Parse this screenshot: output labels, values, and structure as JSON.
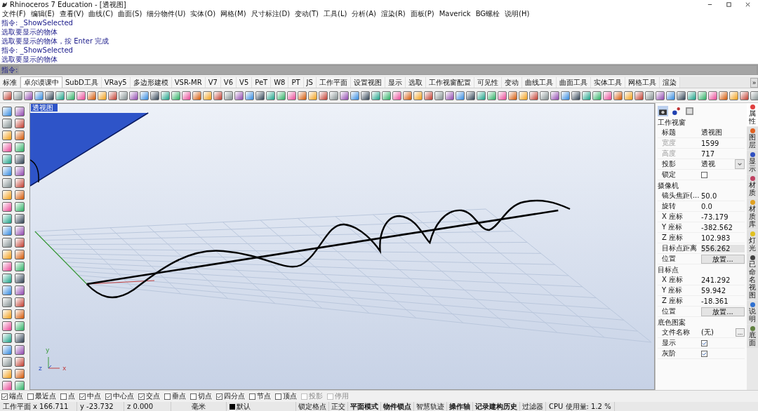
{
  "window": {
    "title": "Rhinoceros 7 Education - [透视图]"
  },
  "menu": [
    "文件(F)",
    "编辑(E)",
    "查看(V)",
    "曲线(C)",
    "曲面(S)",
    "细分物件(U)",
    "实体(O)",
    "网格(M)",
    "尺寸标注(D)",
    "变动(T)",
    "工具(L)",
    "分析(A)",
    "渲染(R)",
    "面板(P)",
    "Maverick",
    "BG螺栓",
    "说明(H)"
  ],
  "command_history": [
    "指令: _ShowSelected",
    "选取要显示的物体",
    "选取要显示的物体，按 Enter 完成",
    "指令: _ShowSelected",
    "选取要显示的物体"
  ],
  "command_prompt": {
    "label": "指令:"
  },
  "tabs": [
    {
      "label": "标准",
      "selected": false
    },
    {
      "label": "卓尔谟课中",
      "selected": true
    },
    {
      "label": "SubD工具",
      "selected": false
    },
    {
      "label": "VRay5",
      "selected": false
    },
    {
      "label": "多边形建模",
      "selected": false
    },
    {
      "label": "VSR-MR",
      "selected": false
    },
    {
      "label": "V7",
      "selected": false
    },
    {
      "label": "V6",
      "selected": false
    },
    {
      "label": "V5",
      "selected": false
    },
    {
      "label": "PeT",
      "selected": false
    },
    {
      "label": "W8",
      "selected": false
    },
    {
      "label": "PT",
      "selected": false
    },
    {
      "label": "JS",
      "selected": false
    },
    {
      "label": "工作平面",
      "selected": false
    },
    {
      "label": "设置视图",
      "selected": false
    },
    {
      "label": "显示",
      "selected": false
    },
    {
      "label": "选取",
      "selected": false
    },
    {
      "label": "工作视窗配置",
      "selected": false
    },
    {
      "label": "可见性",
      "selected": false
    },
    {
      "label": "变动",
      "selected": false
    },
    {
      "label": "曲线工具",
      "selected": false
    },
    {
      "label": "曲面工具",
      "selected": false
    },
    {
      "label": "实体工具",
      "selected": false
    },
    {
      "label": "网格工具",
      "selected": false
    },
    {
      "label": "渲染",
      "selected": false
    }
  ],
  "tabs_more": "»",
  "viewport": {
    "title": "透视图",
    "axes": [
      "x",
      "y",
      "z"
    ]
  },
  "properties": {
    "sections": [
      {
        "title": "工作视窗",
        "rows": [
          {
            "kind": "text",
            "label": "标题",
            "value": "透视图",
            "disabled": false
          },
          {
            "kind": "text",
            "label": "宽度",
            "value": "1599",
            "disabled": true
          },
          {
            "kind": "text",
            "label": "高度",
            "value": "717",
            "disabled": true
          },
          {
            "kind": "dropdown",
            "label": "投影",
            "value": "透视",
            "disabled": false
          },
          {
            "kind": "checkbox",
            "label": "锁定",
            "checked": false,
            "disabled": false
          }
        ]
      },
      {
        "title": "摄像机",
        "rows": [
          {
            "kind": "text",
            "label": "镜头焦距(...",
            "value": "50.0",
            "disabled": false
          },
          {
            "kind": "text",
            "label": "旋转",
            "value": "0.0",
            "disabled": false
          },
          {
            "kind": "text",
            "label": "X 座标",
            "value": "-73.179",
            "disabled": false
          },
          {
            "kind": "text",
            "label": "Y 座标",
            "value": "-382.562",
            "disabled": false
          },
          {
            "kind": "text",
            "label": "Z 座标",
            "value": "102.983",
            "disabled": false
          },
          {
            "kind": "readonly",
            "label": "目标点距离",
            "value": "556.262",
            "disabled": false
          },
          {
            "kind": "button",
            "label": "位置",
            "value": "放置...",
            "disabled": false
          }
        ]
      },
      {
        "title": "目标点",
        "rows": [
          {
            "kind": "text",
            "label": "X 座标",
            "value": "241.292",
            "disabled": false
          },
          {
            "kind": "text",
            "label": "Y 座标",
            "value": "59.942",
            "disabled": false
          },
          {
            "kind": "text",
            "label": "Z 座标",
            "value": "-18.361",
            "disabled": false
          },
          {
            "kind": "button",
            "label": "位置",
            "value": "放置...",
            "disabled": false
          }
        ]
      },
      {
        "title": "底色图案",
        "rows": [
          {
            "kind": "file",
            "label": "文件名称",
            "value": "(无)",
            "button": "...",
            "disabled": false
          },
          {
            "kind": "checkbox",
            "label": "显示",
            "checked": true,
            "disabled": false
          },
          {
            "kind": "checkbox",
            "label": "灰阶",
            "checked": true,
            "disabled": false
          }
        ]
      }
    ]
  },
  "side_tabs": [
    {
      "label": "属性",
      "color": "#e04040",
      "selected": true
    },
    {
      "label": "图层",
      "color": "#e06020",
      "selected": false
    },
    {
      "label": "显示",
      "color": "#3050c0",
      "selected": false
    },
    {
      "label": "材质",
      "color": "#c04060",
      "selected": false
    },
    {
      "label": "材质库",
      "color": "#e0a020",
      "selected": false
    },
    {
      "label": "灯光",
      "color": "#e0c020",
      "selected": false
    },
    {
      "label": "已命名视图",
      "color": "#404040",
      "selected": false
    },
    {
      "label": "说明",
      "color": "#3070d0",
      "selected": false
    },
    {
      "label": "底面",
      "color": "#608040",
      "selected": false
    }
  ],
  "osnaps": [
    {
      "label": "端点",
      "checked": true,
      "disabled": false
    },
    {
      "label": "最近点",
      "checked": false,
      "disabled": false
    },
    {
      "label": "点",
      "checked": false,
      "disabled": false
    },
    {
      "label": "中点",
      "checked": true,
      "disabled": false
    },
    {
      "label": "中心点",
      "checked": true,
      "disabled": false
    },
    {
      "label": "交点",
      "checked": true,
      "disabled": false
    },
    {
      "label": "垂点",
      "checked": false,
      "disabled": false
    },
    {
      "label": "切点",
      "checked": false,
      "disabled": false
    },
    {
      "label": "四分点",
      "checked": true,
      "disabled": false
    },
    {
      "label": "节点",
      "checked": false,
      "disabled": false
    },
    {
      "label": "顶点",
      "checked": false,
      "disabled": false
    },
    {
      "label": "投影",
      "checked": false,
      "disabled": true
    },
    {
      "label": "停用",
      "checked": false,
      "disabled": true
    }
  ],
  "status_bar": {
    "cplane": "工作平面",
    "x": "x 166.711",
    "y": "y -23.732",
    "z": "z 0.000",
    "units": "毫米",
    "layer": {
      "label": "默认",
      "color": "#000000"
    },
    "toggles": [
      {
        "label": "锁定格点",
        "on": false
      },
      {
        "label": "正交",
        "on": false
      },
      {
        "label": "平面模式",
        "on": true
      },
      {
        "label": "物件锁点",
        "on": true
      },
      {
        "label": "智慧轨迹",
        "on": false
      },
      {
        "label": "操作轴",
        "on": true
      },
      {
        "label": "记录建构历史",
        "on": true
      },
      {
        "label": "过滤器",
        "on": false
      }
    ],
    "cpu": "CPU 使用量: 1.2 %"
  }
}
